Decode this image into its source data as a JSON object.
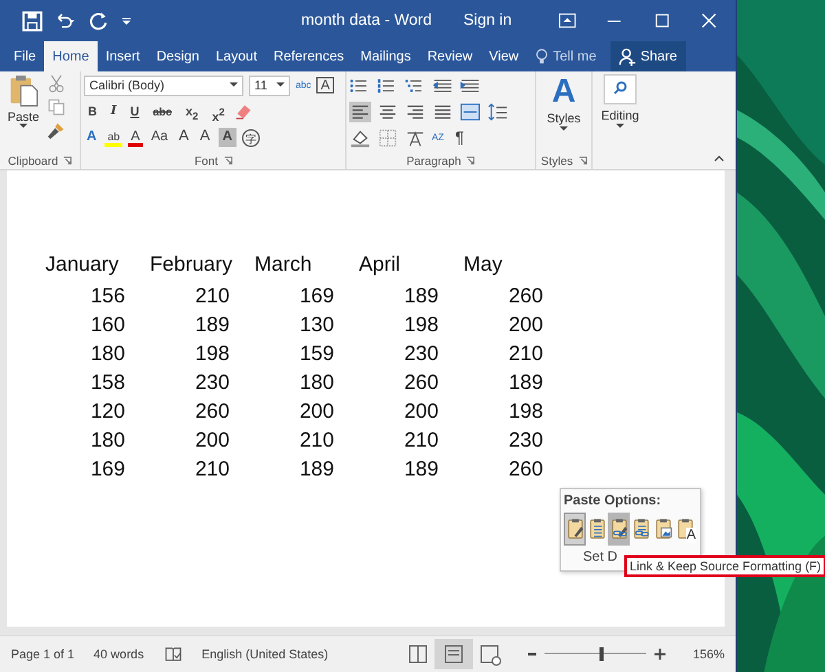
{
  "window": {
    "title": "month data  -  Word",
    "sign_in": "Sign in"
  },
  "tabs": [
    {
      "label": "File",
      "selected": false
    },
    {
      "label": "Home",
      "selected": true
    },
    {
      "label": "Insert",
      "selected": false
    },
    {
      "label": "Design",
      "selected": false
    },
    {
      "label": "Layout",
      "selected": false
    },
    {
      "label": "References",
      "selected": false
    },
    {
      "label": "Mailings",
      "selected": false
    },
    {
      "label": "Review",
      "selected": false
    },
    {
      "label": "View",
      "selected": false
    }
  ],
  "tell_me": "Tell me",
  "share": "Share",
  "clipboard": {
    "paste": "Paste",
    "label": "Clipboard"
  },
  "font": {
    "name": "Calibri (Body)",
    "size": "11",
    "label": "Font",
    "clear_glyph": "abc",
    "border_glyph": "A",
    "format_buttons": [
      {
        "glyph": "B",
        "kind": "bold"
      },
      {
        "glyph": "I",
        "kind": "italic"
      },
      {
        "glyph": "U",
        "kind": "underline"
      },
      {
        "glyph": "abc",
        "kind": "strike"
      },
      {
        "glyph": "x$_{2}$",
        "kind": "plain"
      },
      {
        "glyph": "x$^{2}$",
        "kind": "plain"
      }
    ],
    "effect_buttons": [
      {
        "glyph": "A",
        "kind": "effects"
      },
      {
        "glyph": "ab",
        "kind": "highlight",
        "color": "#ffff00"
      },
      {
        "glyph": "A",
        "kind": "color",
        "color": "#e00000"
      },
      {
        "glyph": "Aa",
        "kind": "case"
      },
      {
        "glyph": "A",
        "kind": "grow"
      },
      {
        "glyph": "A",
        "kind": "shrink"
      },
      {
        "glyph": "A",
        "kind": "shaded"
      },
      {
        "glyph": "字",
        "kind": "circled"
      }
    ]
  },
  "paragraph": {
    "label": "Paragraph",
    "alignments": [
      {
        "selected": true
      },
      {
        "selected": false
      },
      {
        "selected": false
      },
      {
        "selected": false
      }
    ],
    "sort_glyph": "AZ",
    "pilcrow": "¶"
  },
  "styles": {
    "glyph": "A",
    "label": "Styles",
    "group_label": "Styles"
  },
  "editing": {
    "label": "Editing"
  },
  "table": {
    "columns": [
      "January",
      "February",
      "March",
      "April",
      "May"
    ],
    "rows": [
      [
        "156",
        "210",
        "169",
        "189",
        "260"
      ],
      [
        "160",
        "189",
        "130",
        "198",
        "200"
      ],
      [
        "180",
        "198",
        "159",
        "230",
        "210"
      ],
      [
        "158",
        "230",
        "180",
        "260",
        "189"
      ],
      [
        "120",
        "260",
        "200",
        "200",
        "198"
      ],
      [
        "180",
        "200",
        "210",
        "210",
        "230"
      ],
      [
        "169",
        "210",
        "189",
        "189",
        "260"
      ]
    ]
  },
  "paste_options": {
    "title": "Paste Options:",
    "items": [
      {
        "kind": "keep",
        "selected": true,
        "hovered": false
      },
      {
        "kind": "merge",
        "selected": false,
        "hovered": false
      },
      {
        "kind": "link-keep",
        "selected": false,
        "hovered": true
      },
      {
        "kind": "link-merge",
        "selected": false,
        "hovered": false
      },
      {
        "kind": "picture",
        "selected": false,
        "hovered": false
      },
      {
        "kind": "text",
        "glyph": "A",
        "selected": false,
        "hovered": false
      }
    ],
    "set_default": "Set D",
    "tooltip": "Link & Keep Source Formatting (F)"
  },
  "status_bar": {
    "page": "Page 1 of 1",
    "words": "40 words",
    "language": "English (United States)",
    "zoom": "156%",
    "level": 0.56,
    "views": [
      {
        "selected": false
      },
      {
        "selected": true
      },
      {
        "selected": false
      }
    ]
  }
}
